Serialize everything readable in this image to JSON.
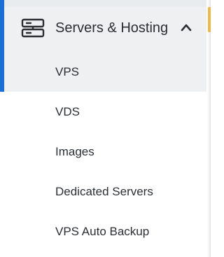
{
  "section": {
    "label": "Servers & Hosting",
    "icon": "server-icon",
    "expand_icon": "chevron-up-icon",
    "expanded": true
  },
  "menu": {
    "items": [
      {
        "label": "VPS",
        "active": true
      },
      {
        "label": "VDS",
        "active": false
      },
      {
        "label": "Images",
        "active": false
      },
      {
        "label": "Dedicated Servers",
        "active": false
      },
      {
        "label": "VPS Auto Backup",
        "active": false
      }
    ]
  },
  "colors": {
    "active_indicator": "#1a6fd6",
    "active_background": "#eef0f1",
    "text": "#2b2f33",
    "side_accent": "#f0b74a"
  }
}
